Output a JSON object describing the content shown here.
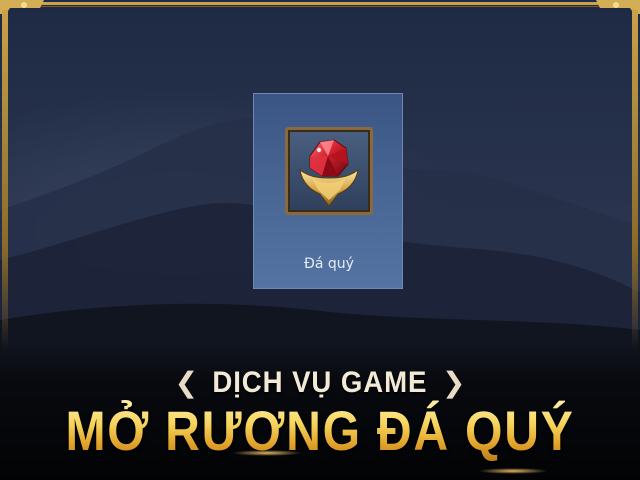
{
  "item": {
    "label": "Đá quý",
    "icon": "red-gem-shield-icon"
  },
  "banner": {
    "service_label": "DỊCH VỤ GAME",
    "left_chevron": "❮",
    "right_chevron": "❯",
    "headline": "MỞ RƯƠNG ĐÁ QUÝ"
  },
  "colors": {
    "card_bg": "#4a6896",
    "frame_gold": "#c9a24a",
    "headline_gold": "#f3c548",
    "gem_red": "#d0202e",
    "background": "#1c2538"
  }
}
